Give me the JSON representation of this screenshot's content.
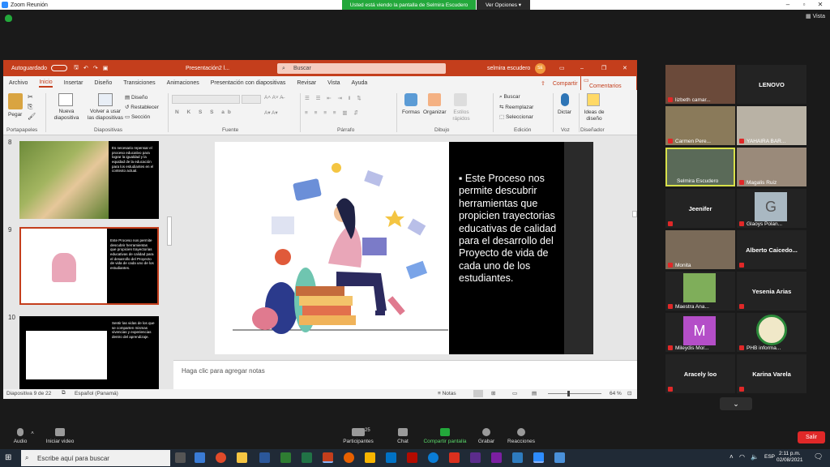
{
  "zoom": {
    "title": "Zoom Reunión",
    "banner": "Usted está viendo la pantalla de Selmira Escudero",
    "view_options": "Ver Opciones",
    "vista": "Vista"
  },
  "ppt": {
    "autosave": "Autoguardado",
    "doc_title": "Presentación2 l...",
    "search_placeholder": "Buscar",
    "user": "selmira escudero",
    "user_initials": "SE",
    "tabs": [
      "Archivo",
      "Inicio",
      "Insertar",
      "Diseño",
      "Transiciones",
      "Animaciones",
      "Presentación con diapositivas",
      "Revisar",
      "Vista",
      "Ayuda"
    ],
    "share": "Compartir",
    "comments": "Comentarios",
    "ribbon": {
      "paste": "Pegar",
      "clipboard": "Portapapeles",
      "new_slide": "Nueva diapositiva",
      "reuse": "Volver a usar las diapositivas",
      "layout": "Diseño",
      "reset": "Restablecer",
      "section": "Sección",
      "slides": "Diapositivas",
      "font": "Fuente",
      "paragraph": "Párrafo",
      "shapes": "Formas",
      "arrange": "Organizar",
      "quick_styles": "Estilos rápidos",
      "drawing": "Dibujo",
      "find": "Buscar",
      "replace": "Reemplazar",
      "select": "Seleccionar",
      "editing": "Edición",
      "dictate": "Dictar",
      "voice": "Voz",
      "design_ideas": "Ideas de diseño",
      "designer": "Diseñador"
    },
    "slide_nums": [
      "8",
      "9",
      "10"
    ],
    "thumb9_text": "Este Proceso nos permite descubrir herramientas que propicien trayectorias educativas de calidad para el desarrollo del Proyecto de vida de cada uno de los estudiantes.",
    "thumb8_text": "Es necesario repensar el proceso educativo para lograr la igualdad y la equidad de la educación para los estudiantes en el contexto actual.",
    "thumb10_text": "Sentir las vidas de los que se comparten mismas vivencias y experiencias dentro del aprendizaje.",
    "slide_text": "Este Proceso nos permite descubrir herramientas que propicien trayectorias educativas de calidad para el desarrollo del Proyecto de vida de cada uno de los estudiantes.",
    "notes_placeholder": "Haga clic para agregar notas",
    "status_slide": "Diapositiva 9 de 22",
    "status_lang": "Español (Panamá)",
    "status_notes": "Notas",
    "zoom_level": "64 %"
  },
  "participants": [
    {
      "name": "lizbeth camar..."
    },
    {
      "name": "LENOVO"
    },
    {
      "name": "Carmen Pere..."
    },
    {
      "name": "YAHAIRA BAR..."
    },
    {
      "name": "Selmira Escudero"
    },
    {
      "name": "Magalis Ruiz"
    },
    {
      "name": "Jeenifer"
    },
    {
      "name": "Glaoys Polan..."
    },
    {
      "name": "Monita"
    },
    {
      "name": "Alberto Caicedo..."
    },
    {
      "name": "Maestra Ana..."
    },
    {
      "name": "Yesenia Arias"
    },
    {
      "name": "Mileydis Mor..."
    },
    {
      "name": "PHB informa..."
    },
    {
      "name": "Aracely loo"
    },
    {
      "name": "Karina Varela"
    }
  ],
  "avatar_letters": {
    "glaoys": "G",
    "mileydis": "M"
  },
  "toolbar": {
    "audio": "Audio",
    "video": "Iniciar video",
    "participants": "Participantes",
    "participants_count": "25",
    "chat": "Chat",
    "share": "Compartir pantalla",
    "record": "Grabar",
    "reactions": "Reacciones",
    "leave": "Salir"
  },
  "taskbar": {
    "search": "Escribe aquí para buscar",
    "lang": "ESP",
    "time": "2:11 p.m.",
    "date": "02/08/2021"
  },
  "colors": {
    "ppt_red": "#c43e1c",
    "zoom_green": "#23a83b",
    "leave_red": "#e02828"
  }
}
